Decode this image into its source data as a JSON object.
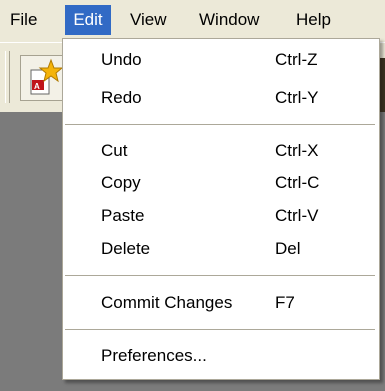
{
  "menubar": {
    "items": [
      {
        "label": "File"
      },
      {
        "label": "Edit"
      },
      {
        "label": "View"
      },
      {
        "label": "Window"
      },
      {
        "label": "Help"
      }
    ],
    "active": "Edit"
  },
  "edit_menu": {
    "items": [
      {
        "label": "Undo",
        "shortcut": "Ctrl-Z"
      },
      {
        "label": "Redo",
        "shortcut": "Ctrl-Y"
      },
      {
        "label": "Cut",
        "shortcut": "Ctrl-X"
      },
      {
        "label": "Copy",
        "shortcut": "Ctrl-C"
      },
      {
        "label": "Paste",
        "shortcut": "Ctrl-V"
      },
      {
        "label": "Delete",
        "shortcut": "Del"
      },
      {
        "label": "Commit Changes",
        "shortcut": "F7"
      },
      {
        "label": "Preferences...",
        "shortcut": ""
      }
    ]
  },
  "toolbar": {
    "button_icon": "star-document-icon"
  },
  "colors": {
    "menu_highlight": "#316ac5",
    "chrome": "#ece9d8",
    "workspace": "#7b7b7b"
  }
}
